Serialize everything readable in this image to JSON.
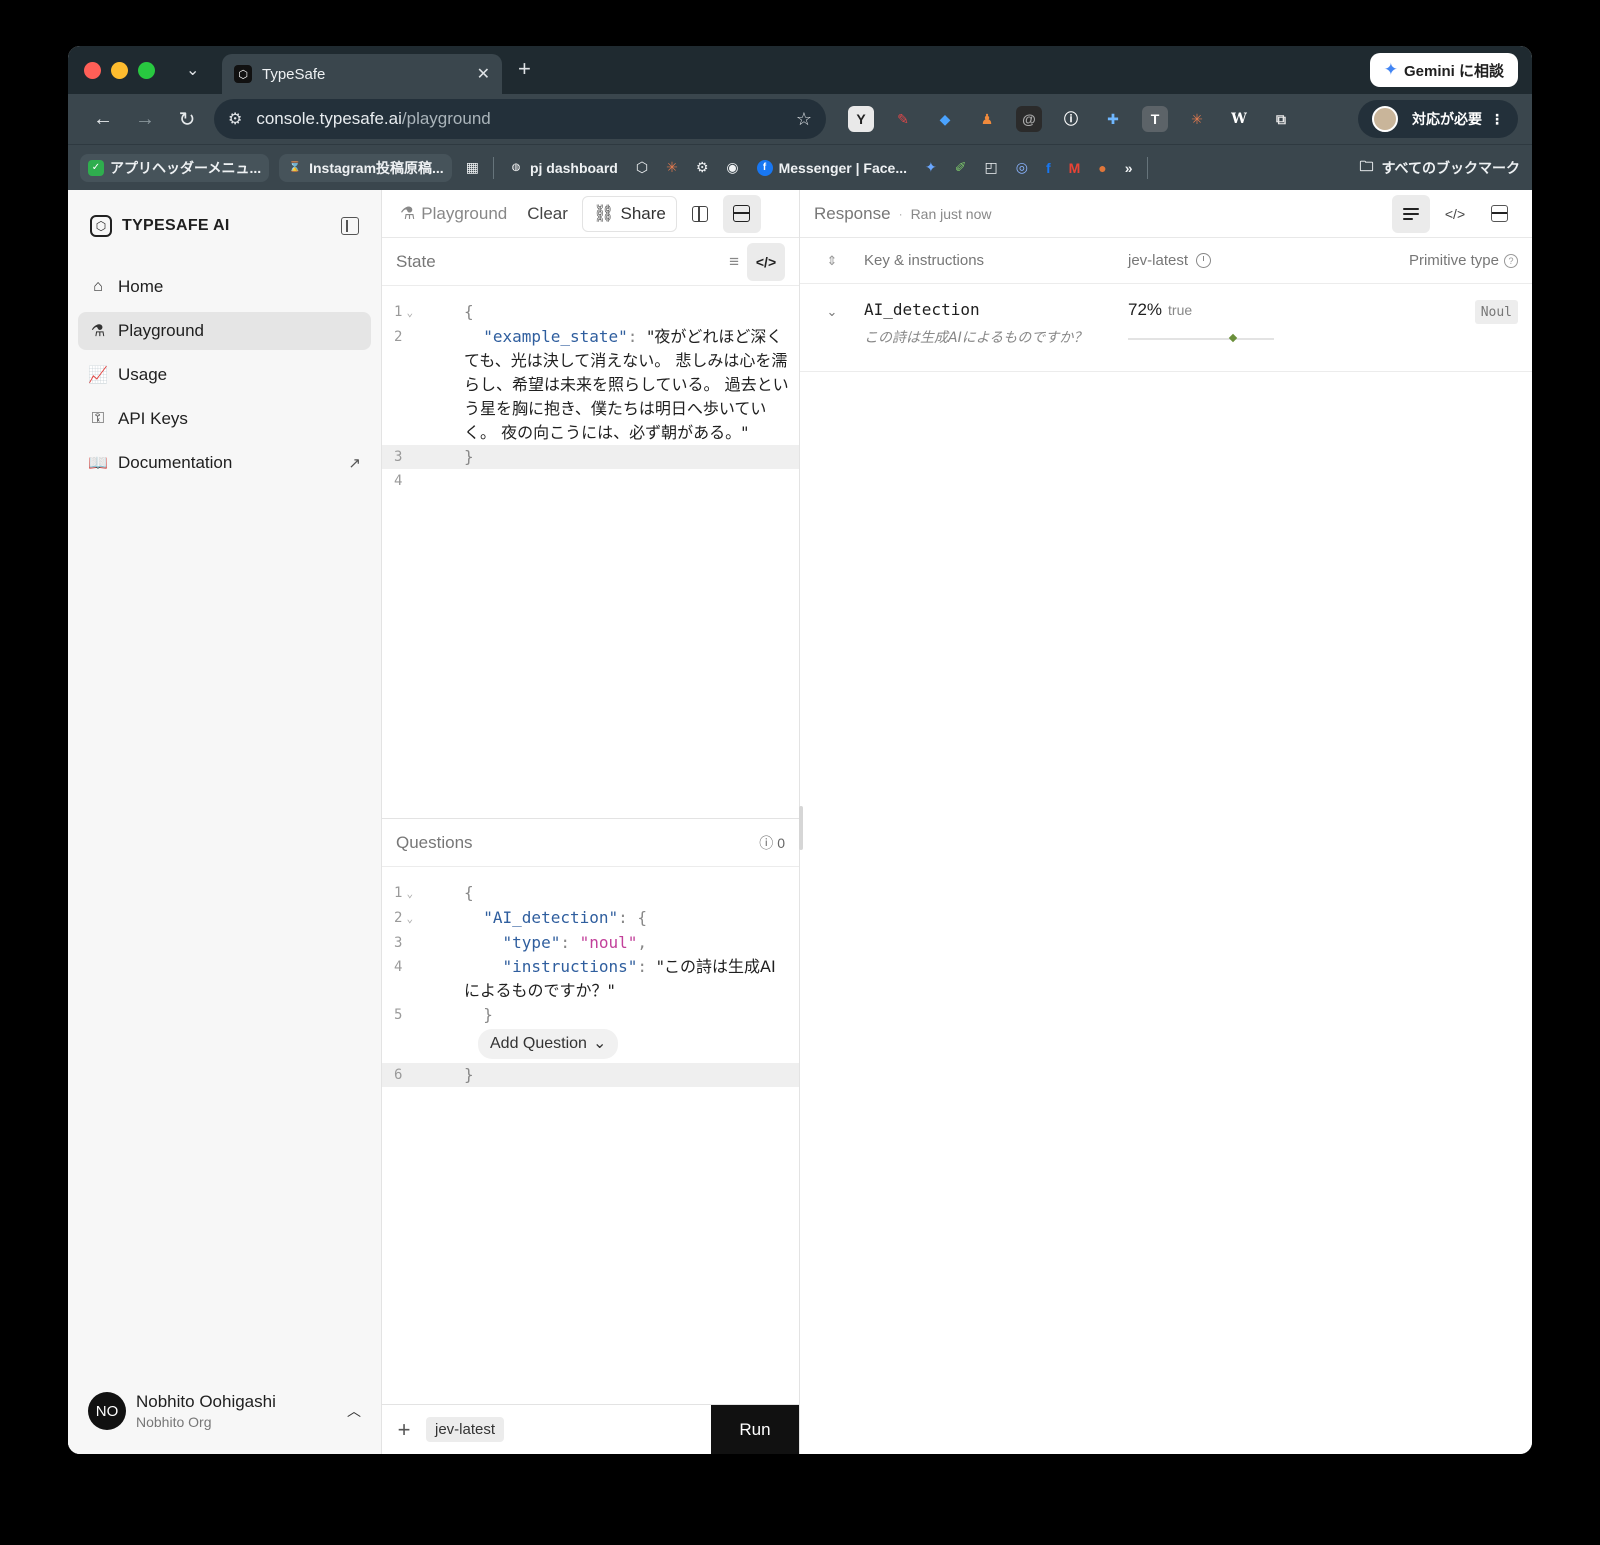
{
  "browser": {
    "tab_title": "TypeSafe",
    "url_host": "console.typesafe.ai",
    "url_path": "/playground",
    "gemini_label": "Gemini に相談",
    "profile_label": "対応が必要",
    "bookmarks": [
      "アプリヘッダーメニュ...",
      "Instagram投稿原稿...",
      "pj dashboard",
      "Messenger | Face..."
    ],
    "all_bookmarks": "すべてのブックマーク"
  },
  "sidebar": {
    "brand": "TYPESAFE AI",
    "items": [
      {
        "label": "Home",
        "icon": "home-icon"
      },
      {
        "label": "Playground",
        "icon": "flask-icon"
      },
      {
        "label": "Usage",
        "icon": "chart-icon"
      },
      {
        "label": "API Keys",
        "icon": "key-icon"
      },
      {
        "label": "Documentation",
        "icon": "book-icon"
      }
    ],
    "user": {
      "initials": "NO",
      "name": "Nobhito Oohigashi",
      "org": "Nobhito Org"
    }
  },
  "editor": {
    "crumb": "Playground",
    "clear_label": "Clear",
    "share_label": "Share",
    "state_title": "State",
    "state_key": "\"example_state\"",
    "state_value": "\"夜がどれほど深くても、光は決して消えない。 悲しみは心を濡らし、希望は未来を照らしている。 過去という星を胸に抱き、僕たちは明日へ歩いていく。 夜の向こうには、必ず朝がある。\"",
    "questions_title": "Questions",
    "questions_count": "0",
    "q_key": "\"AI_detection\"",
    "q_type_key": "\"type\"",
    "q_type_val": "\"noul\"",
    "q_instr_key": "\"instructions\"",
    "q_instr_val": "\"この詩は生成AIによるものですか？\"",
    "add_question": "Add Question",
    "model": "jev-latest",
    "run_label": "Run"
  },
  "response": {
    "title": "Response",
    "subtitle": "Ran just now",
    "col_key": "Key & instructions",
    "col_model": "jev-latest",
    "col_type": "Primitive type",
    "row": {
      "key": "AI_detection",
      "instructions": "この詩は生成AIによるものですか？",
      "percent": "72%",
      "bool": "true",
      "confidence": 0.72,
      "type": "Noul"
    }
  },
  "colors": {
    "accent_marker": "#6a8f3a",
    "run_button": "#111111"
  }
}
